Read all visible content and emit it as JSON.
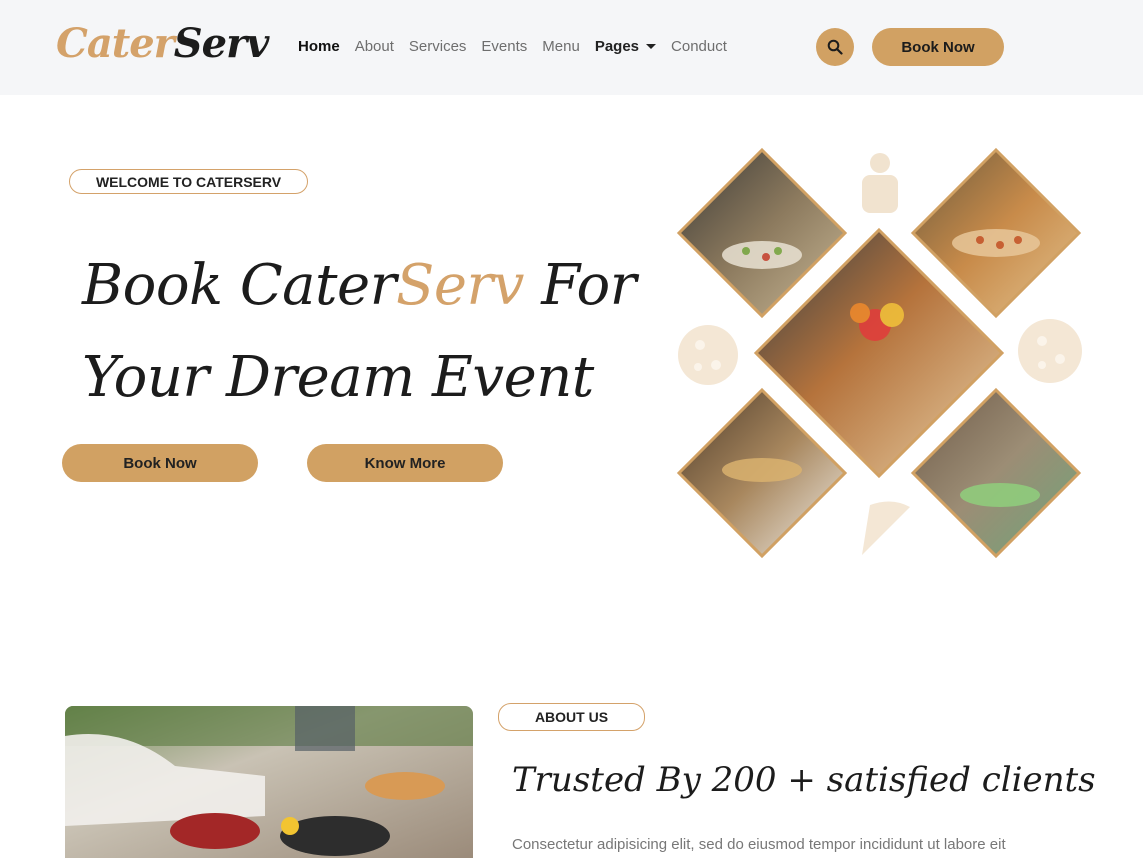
{
  "brand": {
    "logo_part1": "Cater",
    "logo_part2": "Serv"
  },
  "nav": {
    "items": [
      {
        "label": "Home",
        "state": "active"
      },
      {
        "label": "About"
      },
      {
        "label": "Services"
      },
      {
        "label": "Events"
      },
      {
        "label": "Menu"
      },
      {
        "label": "Pages",
        "has_dropdown": true
      },
      {
        "label": "Conduct"
      }
    ],
    "search_icon": "search-icon",
    "book_label": "Book Now"
  },
  "hero": {
    "badge": "WELCOME TO CATERSERV",
    "title_line1_a": "Book Cater",
    "title_line1_gold": "Serv",
    "title_line1_b": " For",
    "title_line2": "Your Dream Event",
    "btn_primary": "Book Now",
    "btn_secondary": "Know More"
  },
  "about": {
    "badge": "ABOUT US",
    "title": "Trusted By 200 + satisfied clients",
    "text": "Consectetur adipisicing elit, sed do eiusmod tempor incididunt ut labore eit"
  },
  "colors": {
    "accent": "#d1a163",
    "navbar_bg": "#f5f6f8",
    "text": "#1c1c1c"
  }
}
